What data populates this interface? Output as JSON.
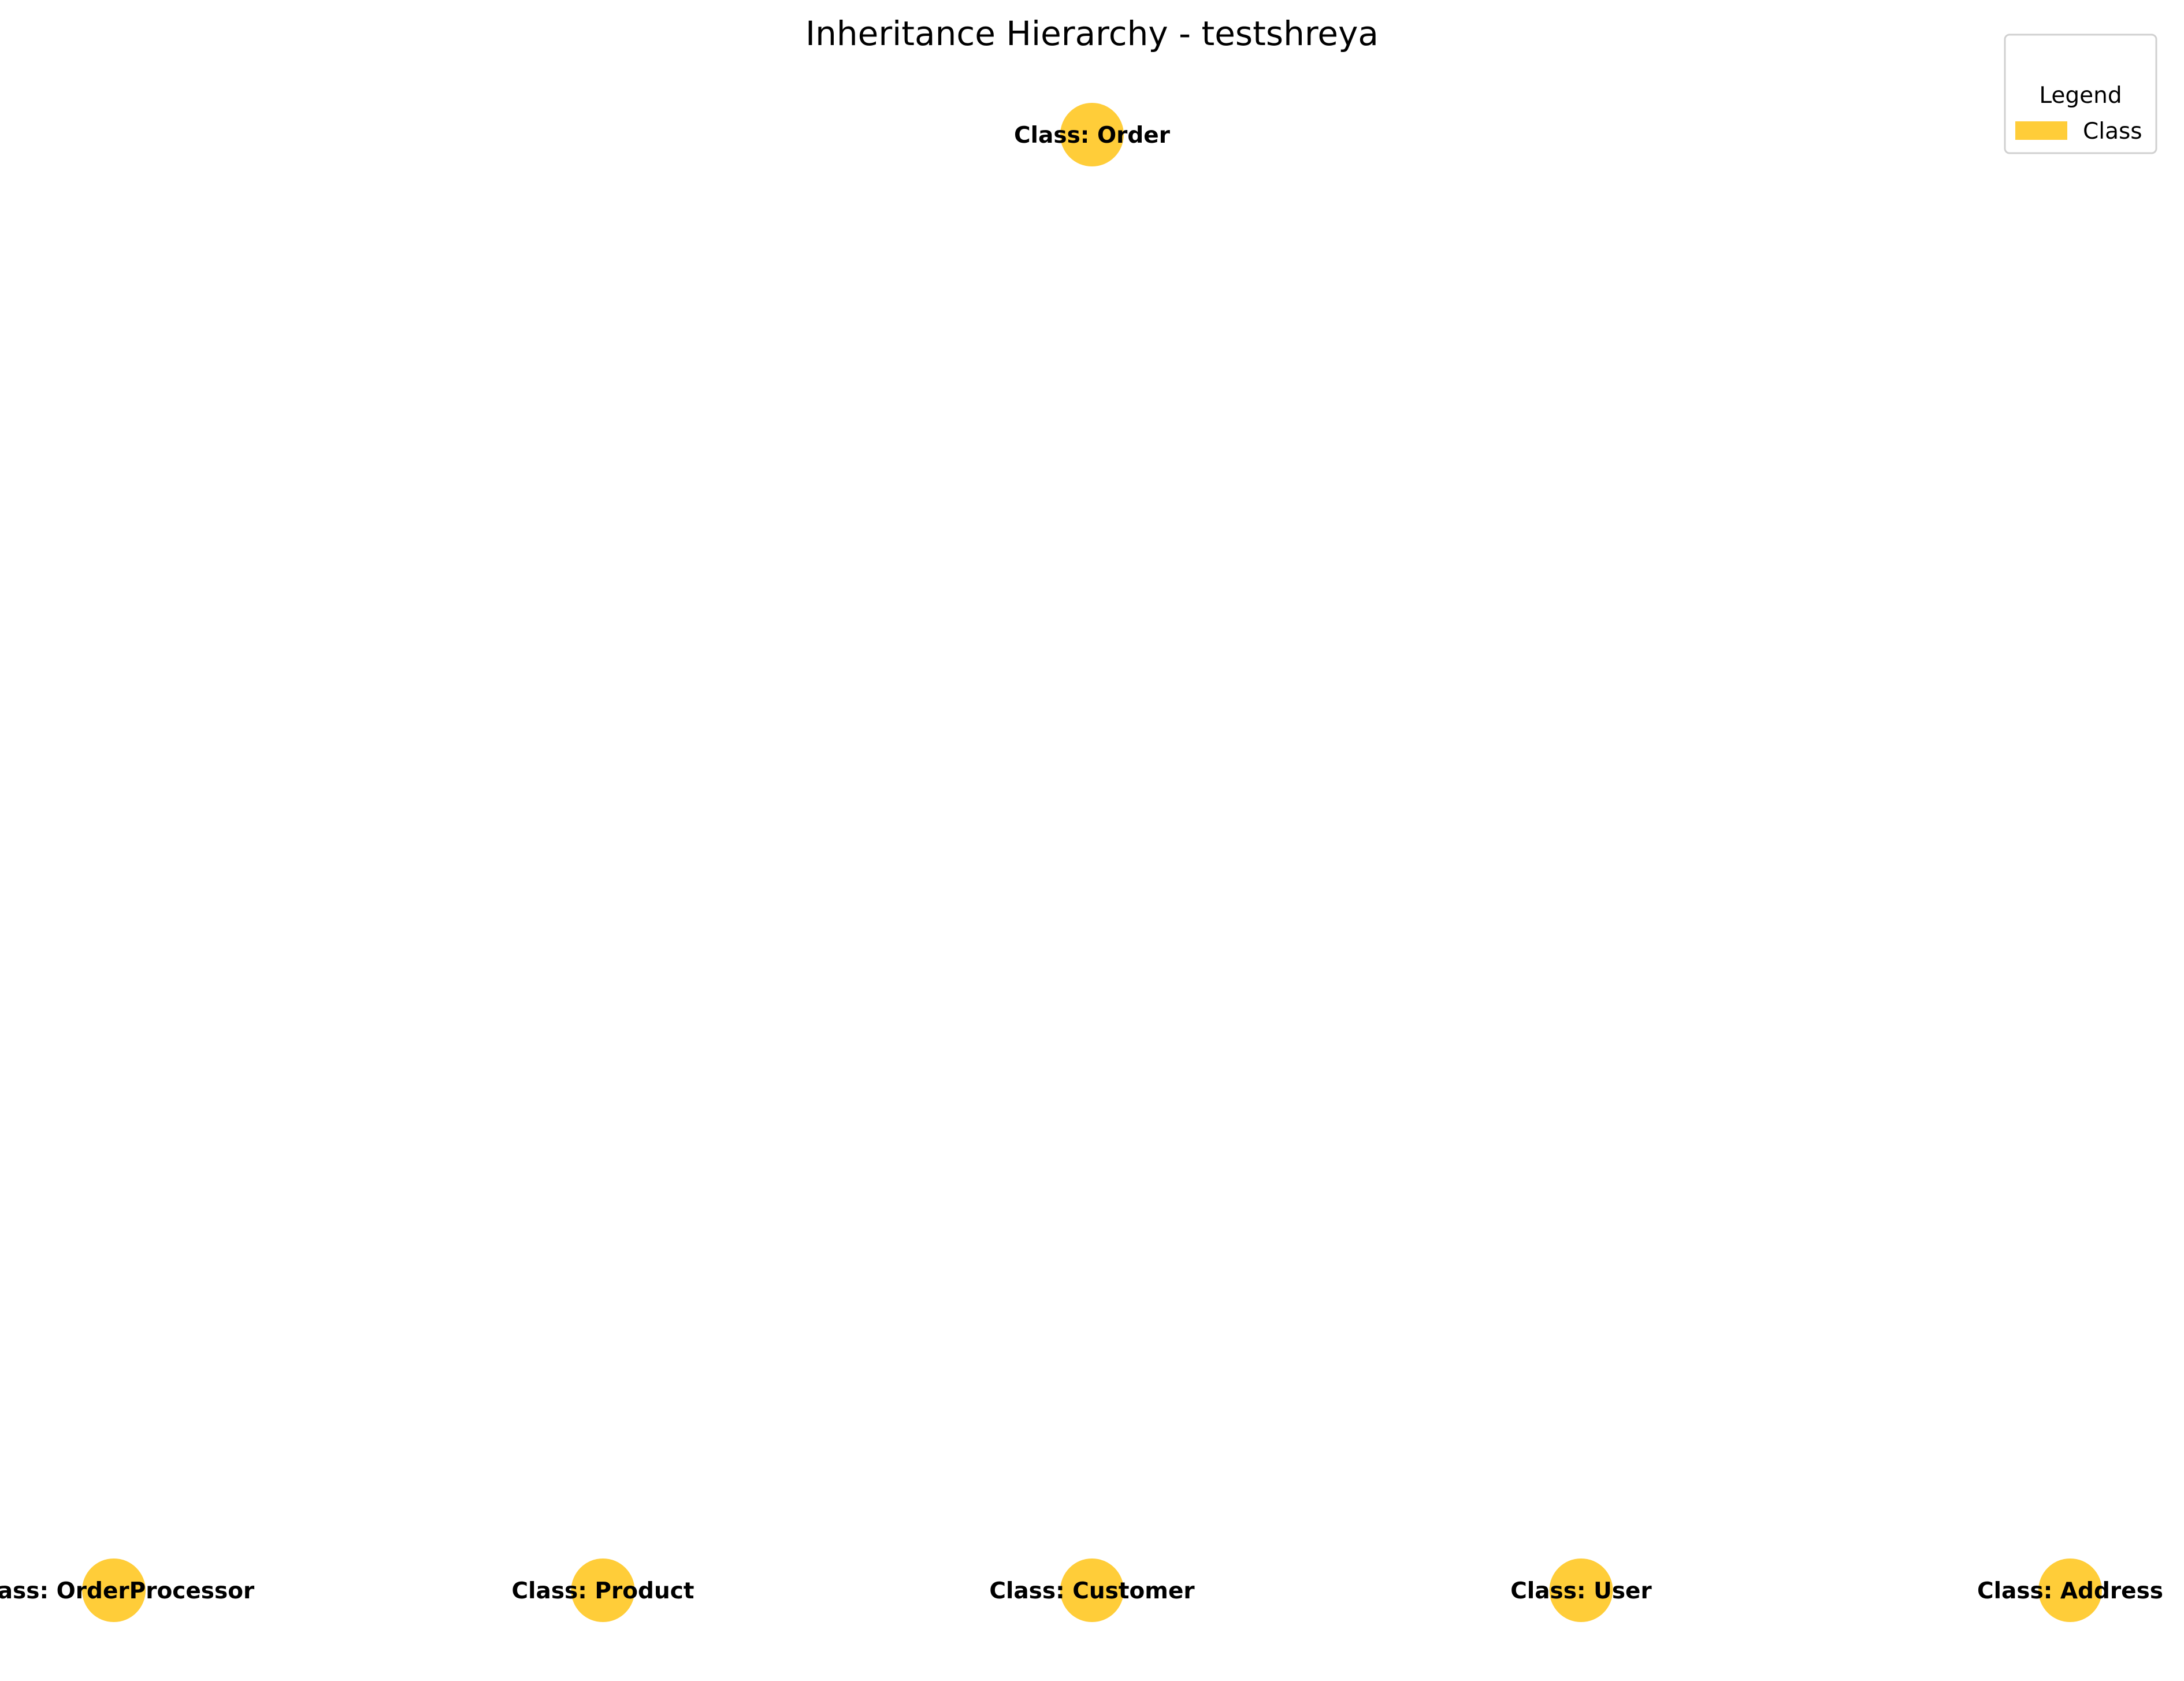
{
  "title": "Inheritance Hierarchy - testshreya",
  "node_color": "#FFC107",
  "node_opacity": 0.8,
  "node_text_color": "#000000",
  "nodes": [
    {
      "id": "order",
      "label": "Class: Order",
      "level": 0
    },
    {
      "id": "orderprocessor",
      "label": "Class: OrderProcessor",
      "level": 1
    },
    {
      "id": "product",
      "label": "Class: Product",
      "level": 1
    },
    {
      "id": "customer",
      "label": "Class: Customer",
      "level": 1
    },
    {
      "id": "user",
      "label": "Class: User",
      "level": 1
    },
    {
      "id": "address",
      "label": "Class: Address",
      "level": 1
    }
  ],
  "edges": [],
  "legend": {
    "title": "Legend",
    "items": [
      {
        "label": "Class",
        "color": "#FFC107"
      }
    ]
  }
}
